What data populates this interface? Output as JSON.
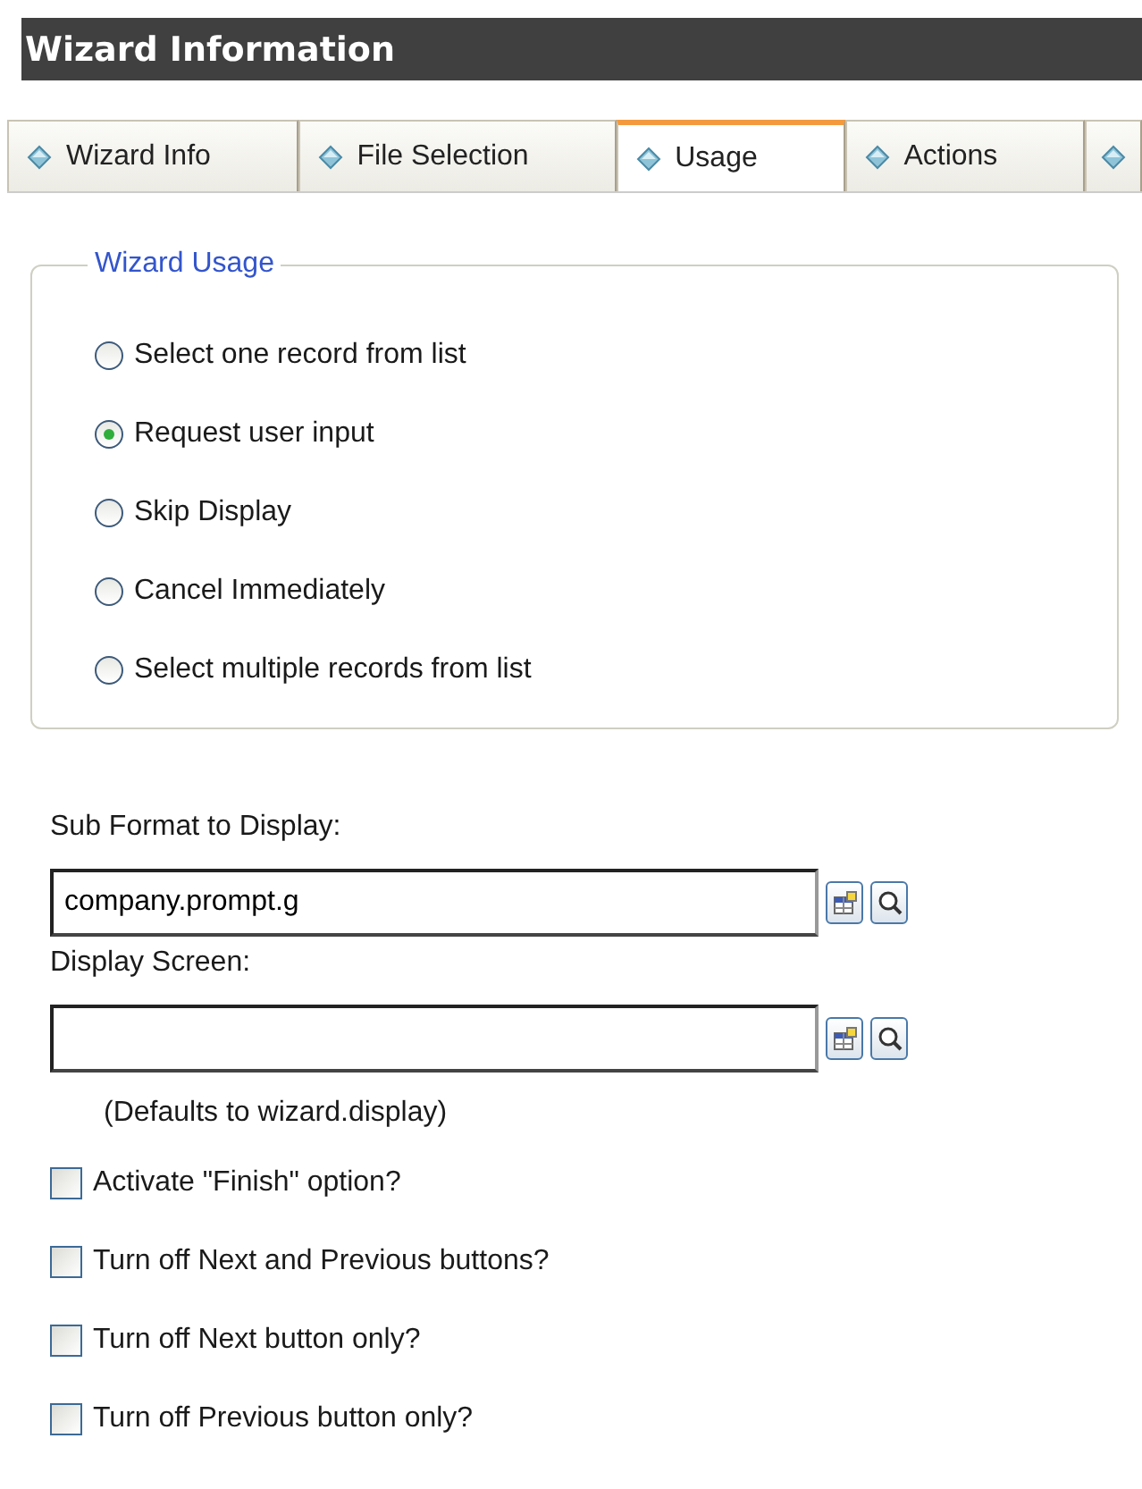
{
  "header": {
    "title": "Wizard Information"
  },
  "tabs": [
    {
      "label": "Wizard Info",
      "selected": false
    },
    {
      "label": "File Selection",
      "selected": false
    },
    {
      "label": "Usage",
      "selected": true
    },
    {
      "label": "Actions",
      "selected": false
    },
    {
      "selected": false
    }
  ],
  "usage_group": {
    "legend": "Wizard Usage",
    "options": [
      {
        "label": "Select one record from list",
        "selected": false
      },
      {
        "label": "Request user input",
        "selected": true
      },
      {
        "label": "Skip Display",
        "selected": false
      },
      {
        "label": "Cancel Immediately",
        "selected": false
      },
      {
        "label": "Select multiple records from list",
        "selected": false
      }
    ]
  },
  "fields": [
    {
      "label": "Sub Format to Display:",
      "value": "company.prompt.g"
    },
    {
      "label": "Display Screen:",
      "hint": "(Defaults to wizard.display)"
    }
  ],
  "options": [
    {
      "label": "Activate \"Finish\" option?",
      "checked": false
    },
    {
      "label": "Turn off Next and Previous buttons?",
      "checked": false
    },
    {
      "label": "Turn off Next button only?",
      "checked": false
    },
    {
      "label": "Turn off Previous button only?",
      "checked": false
    }
  ]
}
